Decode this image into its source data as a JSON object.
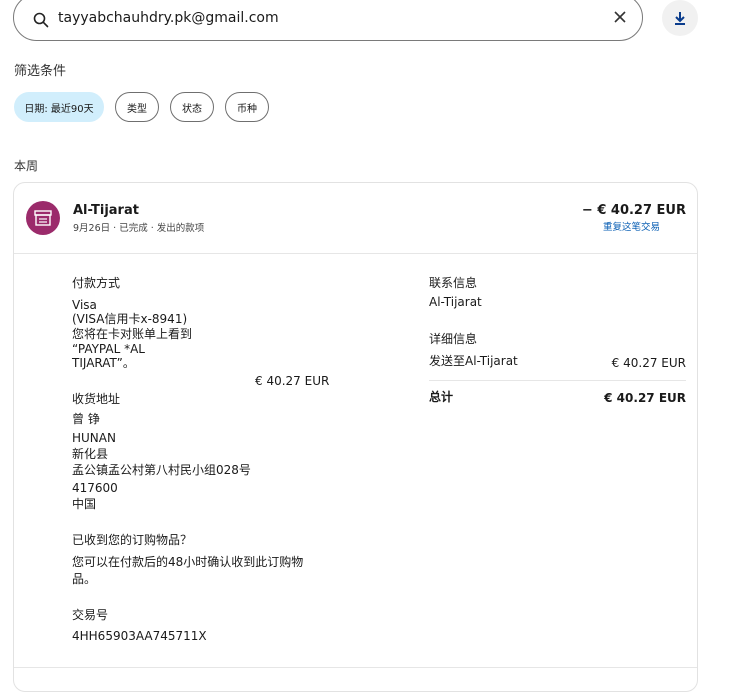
{
  "search": {
    "value": "tayyabchauhdry.pk@gmail.com"
  },
  "filters": {
    "title": "筛选条件",
    "chips": [
      "日期: 最近90天",
      "类型",
      "状态",
      "币种"
    ]
  },
  "section_label": "本周",
  "transaction": {
    "merchant": "Al-Tijarat",
    "meta": "9月26日 · 已完成 · 发出的款项",
    "amount": "− € 40.27 EUR",
    "repeat_link": "重复这笔交易",
    "payment_method": {
      "label": "付款方式",
      "card_name": "Visa",
      "card_detail": "(VISA信用卡x-8941)",
      "statement_note_1": "您将在卡对账单上看到",
      "statement_note_2": "“PAYPAL *AL",
      "statement_note_3": "TIJARAT”。",
      "amount": "€ 40.27 EUR"
    },
    "shipping": {
      "label": "收货地址",
      "lines": [
        "曾 铮",
        "HUNAN",
        "新化县",
        "孟公镇孟公村第八村民小组028号",
        "417600",
        "中国"
      ]
    },
    "received": {
      "question": "已收到您的订购物品？",
      "note_1": "您可以在付款后的48小时确认收到此订购物",
      "note_2": "品。"
    },
    "transaction_id": {
      "label": "交易号",
      "value": "4HH65903AA745711X"
    },
    "contact": {
      "label": "联系信息",
      "name": "Al-Tijarat"
    },
    "details": {
      "label": "详细信息",
      "sent_to": "发送至Al-Tijarat",
      "sent_amount": "€ 40.27 EUR",
      "total_label": "总计",
      "total_amount": "€ 40.27 EUR"
    }
  },
  "icons": {
    "search": "search-icon",
    "clear": "close-icon",
    "download": "download-icon",
    "merchant": "storefront-icon"
  },
  "colors": {
    "accent_link": "#0a5fb4",
    "chip_active": "#d1eefc",
    "merchant_icon_bg": "#9b2b6b"
  }
}
